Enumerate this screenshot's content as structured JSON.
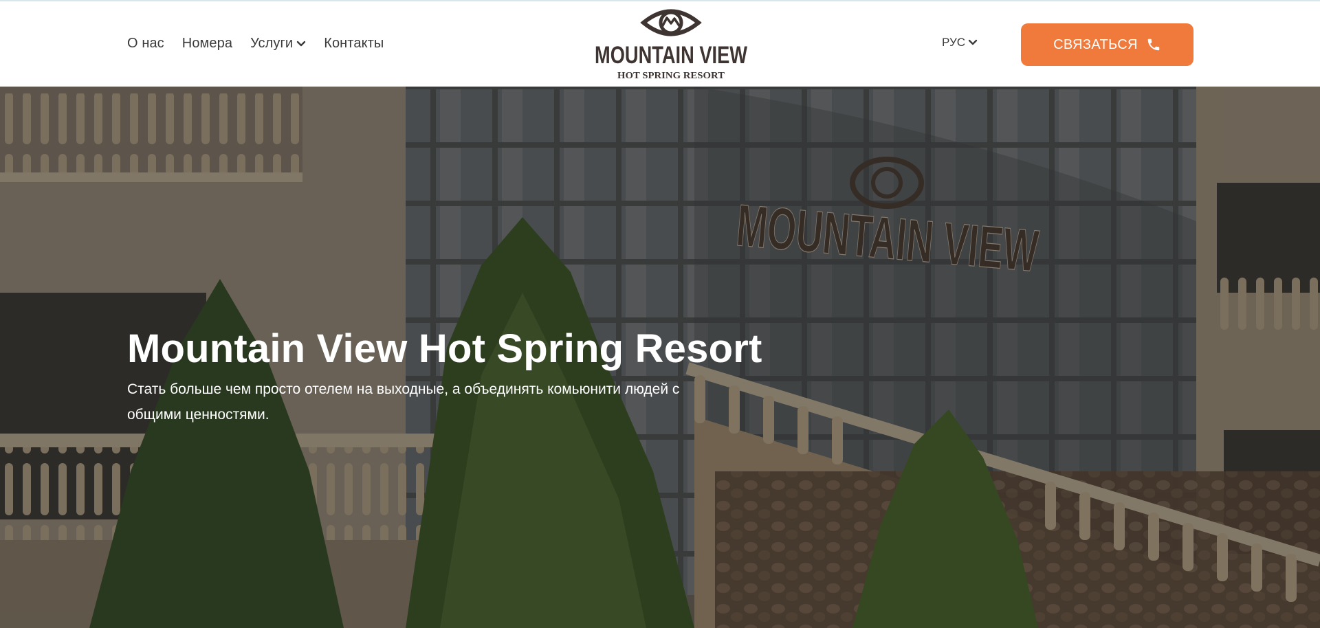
{
  "header": {
    "nav": [
      {
        "label": "О нас"
      },
      {
        "label": "Номера"
      },
      {
        "label": "Услуги",
        "has_dropdown": true
      },
      {
        "label": "Контакты"
      }
    ],
    "logo": {
      "line1": "MOUNTAIN VIEW",
      "line2": "HOT SPRING RESORT"
    },
    "language": "РУС",
    "cta_label": "СВЯЗАТЬСЯ"
  },
  "hero": {
    "title": "Mountain View Hot Spring Resort",
    "subtitle": "Стать больше чем просто отелем на выходные, а объединять комьюнити людей с общими ценностями.",
    "building_sign": "MOUNTAIN VIEW"
  },
  "colors": {
    "accent": "#ef7a3c",
    "text": "#3a3a3a",
    "logo": "#3e3432"
  },
  "icons": [
    "chevron-down-icon",
    "phone-icon",
    "mountain-eye-logo-icon"
  ]
}
